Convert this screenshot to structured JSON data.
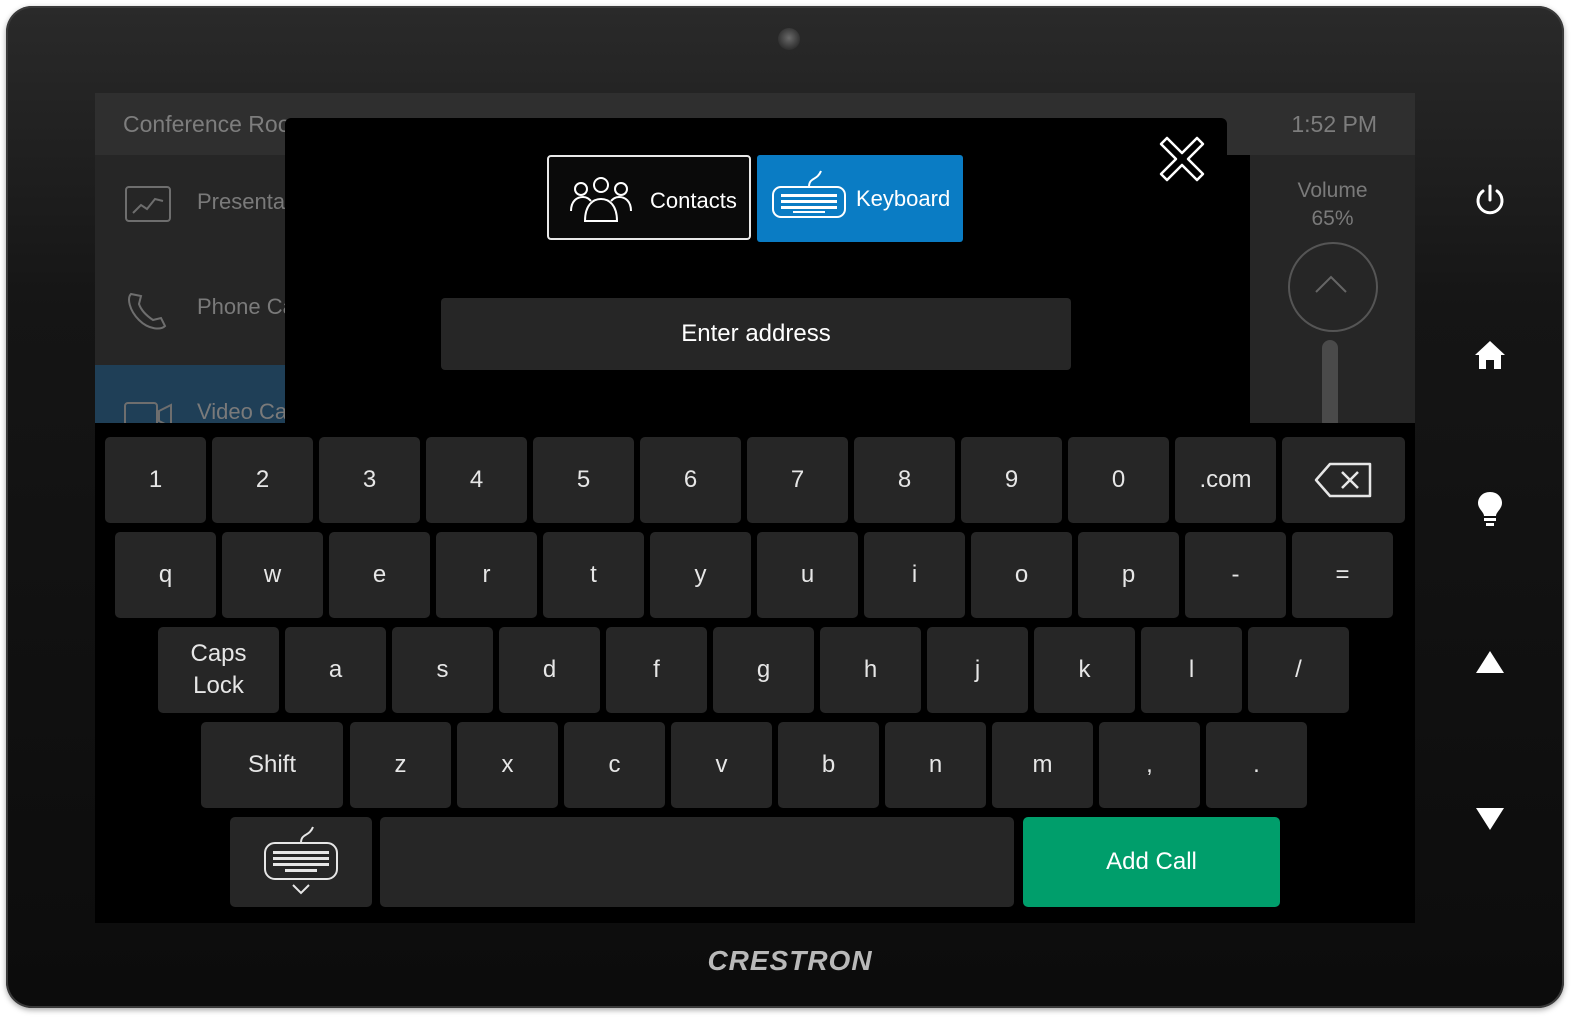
{
  "background_app": {
    "room_name": "Conference Roo",
    "time": "1:52 PM",
    "sidebar": [
      {
        "label": "Presenta",
        "icon": "presentation-icon"
      },
      {
        "label": "Phone Ca",
        "icon": "phone-icon"
      },
      {
        "label": "Video Cal",
        "icon": "video-camera-icon",
        "active": true
      }
    ],
    "volume_label": "Volume",
    "volume_value": "65%"
  },
  "modal": {
    "tabs": [
      {
        "label": "Contacts",
        "icon": "contacts-icon",
        "selected": false
      },
      {
        "label": "Keyboard",
        "icon": "keyboard-icon",
        "selected": true
      }
    ],
    "address_placeholder": "Enter address",
    "accent_color": "#0a7cc4"
  },
  "keyboard": {
    "row1": [
      "1",
      "2",
      "3",
      "4",
      "5",
      "6",
      "7",
      "8",
      "9",
      "0",
      ".com"
    ],
    "row2": [
      "q",
      "w",
      "e",
      "r",
      "t",
      "y",
      "u",
      "i",
      "o",
      "p",
      "-",
      "="
    ],
    "row3_caps": "Caps Lock",
    "row3": [
      "a",
      "s",
      "d",
      "f",
      "g",
      "h",
      "j",
      "k",
      "l",
      "/"
    ],
    "row4_shift": "Shift",
    "row4": [
      "z",
      "x",
      "c",
      "v",
      "b",
      "n",
      "m",
      ",",
      "."
    ],
    "add_call": "Add Call",
    "add_call_color": "#009e6b"
  },
  "device": {
    "brand": "CRESTRON",
    "buttons": [
      "power-icon",
      "home-icon",
      "light-bulb-icon",
      "up-arrow-icon",
      "down-arrow-icon"
    ]
  }
}
